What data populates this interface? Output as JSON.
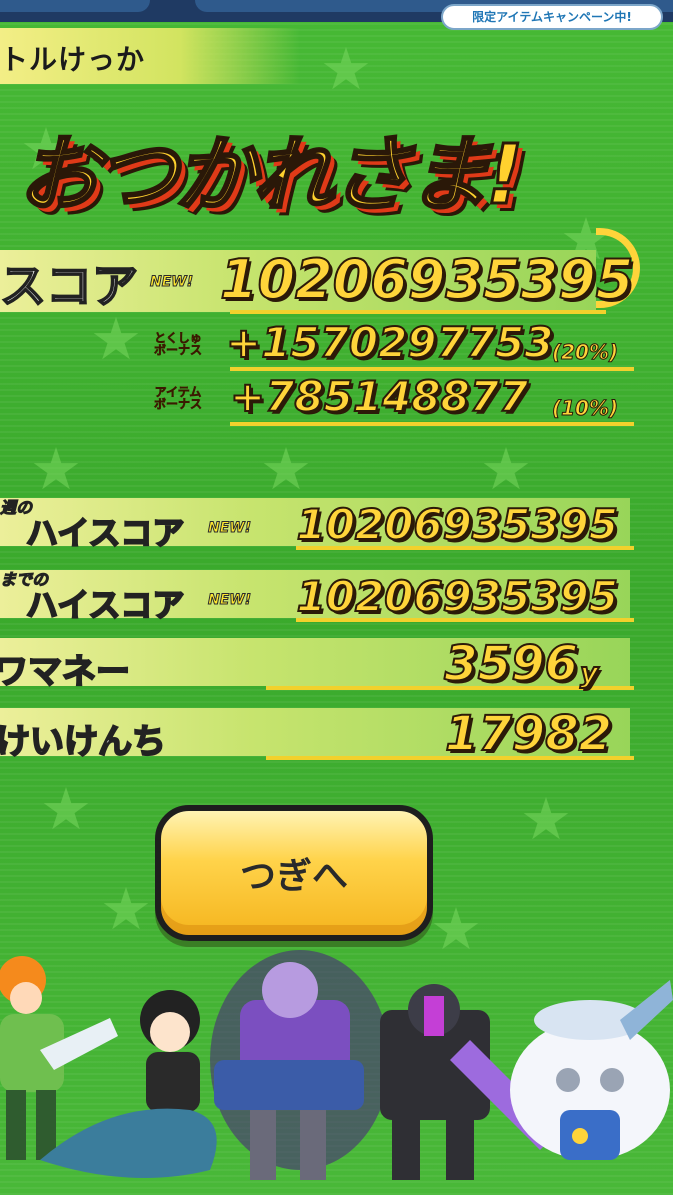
{
  "header": {
    "campaign_badge": "限定アイテムキャンペーン中!",
    "title_fragment": "トルけっか"
  },
  "banner": {
    "text": "おつかれさま!"
  },
  "score": {
    "label_fragment": "スコア",
    "new_badge": "NEW!",
    "value": "10206935395",
    "bonuses": [
      {
        "label_line1": "とくしゅ",
        "label_line2": "ボーナス",
        "value": "+1570297753",
        "percent": "(20%)"
      },
      {
        "label_line1": "アイテム",
        "label_line2": "ボーナス",
        "value": "+785148877",
        "percent": "(10%)"
      }
    ]
  },
  "rows": [
    {
      "prefix": "週の",
      "label": "ハイスコア",
      "badge": "NEW!",
      "value": "10206935395"
    },
    {
      "prefix": "までの",
      "label": "ハイスコア",
      "badge": "NEW!",
      "value": "10206935395"
    },
    {
      "label": "ワマネー",
      "value": "3596",
      "unit": "y"
    },
    {
      "label": "けいけんち",
      "value": "17982"
    }
  ],
  "next_button": {
    "label": "つぎへ"
  },
  "colors": {
    "background": "#3fae2e",
    "gold": "#ffd43a",
    "button": "#ffd34a",
    "band": "#c7e46e",
    "pink_label": "#f06cd2"
  },
  "characters": [
    "orange-haired-girl",
    "mermaid-girl",
    "purple-armored-samurai",
    "black-mech-warrior",
    "white-ghost-creature"
  ]
}
